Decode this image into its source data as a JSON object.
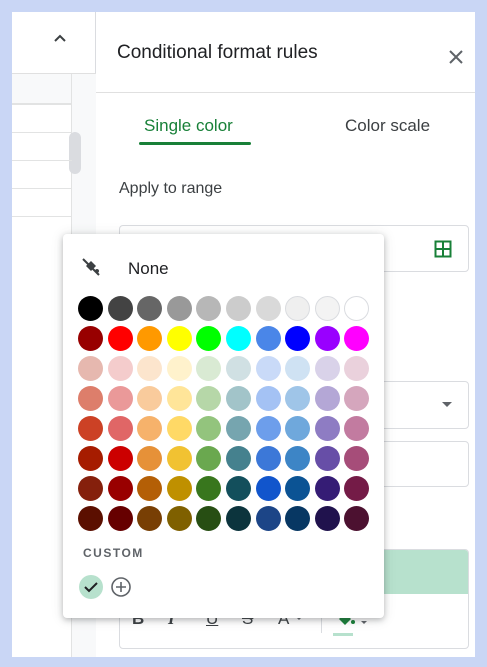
{
  "panel": {
    "title": "Conditional format rules",
    "tabs": [
      {
        "label": "Single color",
        "active": true
      },
      {
        "label": "Color scale",
        "active": false
      }
    ],
    "apply_label": "Apply to range"
  },
  "format_toolbar": {
    "bold": "B",
    "italic": "I",
    "underline": "U",
    "strikethrough": "S",
    "text_color": "A"
  },
  "color_picker": {
    "none_label": "None",
    "custom_label": "CUSTOM",
    "selected_custom": "#b7e1cd",
    "swatches": [
      [
        "#000000",
        "#434343",
        "#666666",
        "#999999",
        "#b7b7b7",
        "#cccccc",
        "#d9d9d9",
        "#efefef",
        "#f3f3f3",
        "#ffffff"
      ],
      [
        "#980000",
        "#ff0000",
        "#ff9900",
        "#ffff00",
        "#00ff00",
        "#00ffff",
        "#4a86e8",
        "#0000ff",
        "#9900ff",
        "#ff00ff"
      ],
      [
        "#e6b8af",
        "#f4cccc",
        "#fce5cd",
        "#fff2cc",
        "#d9ead3",
        "#d0e0e3",
        "#c9daf8",
        "#cfe2f3",
        "#d9d2e9",
        "#ead1dc"
      ],
      [
        "#dd7e6b",
        "#ea9999",
        "#f9cb9c",
        "#ffe599",
        "#b6d7a8",
        "#a2c4c9",
        "#a4c2f4",
        "#9fc5e8",
        "#b4a7d6",
        "#d5a6bd"
      ],
      [
        "#cc4125",
        "#e06666",
        "#f6b26b",
        "#ffd966",
        "#93c47d",
        "#76a5af",
        "#6d9eeb",
        "#6fa8dc",
        "#8e7cc3",
        "#c27ba0"
      ],
      [
        "#a61c00",
        "#cc0000",
        "#e69138",
        "#f1c232",
        "#6aa84f",
        "#45818e",
        "#3c78d8",
        "#3d85c6",
        "#674ea7",
        "#a64d79"
      ],
      [
        "#85200c",
        "#990000",
        "#b45f06",
        "#bf9000",
        "#38761d",
        "#134f5c",
        "#1155cc",
        "#0b5394",
        "#351c75",
        "#741b47"
      ],
      [
        "#5b0f00",
        "#660000",
        "#783f04",
        "#7f6000",
        "#274e13",
        "#0c343d",
        "#1c4587",
        "#073763",
        "#20124d",
        "#4c1130"
      ]
    ]
  },
  "colors": {
    "accent": "#188038",
    "preview_fill": "#b7e1cd"
  }
}
